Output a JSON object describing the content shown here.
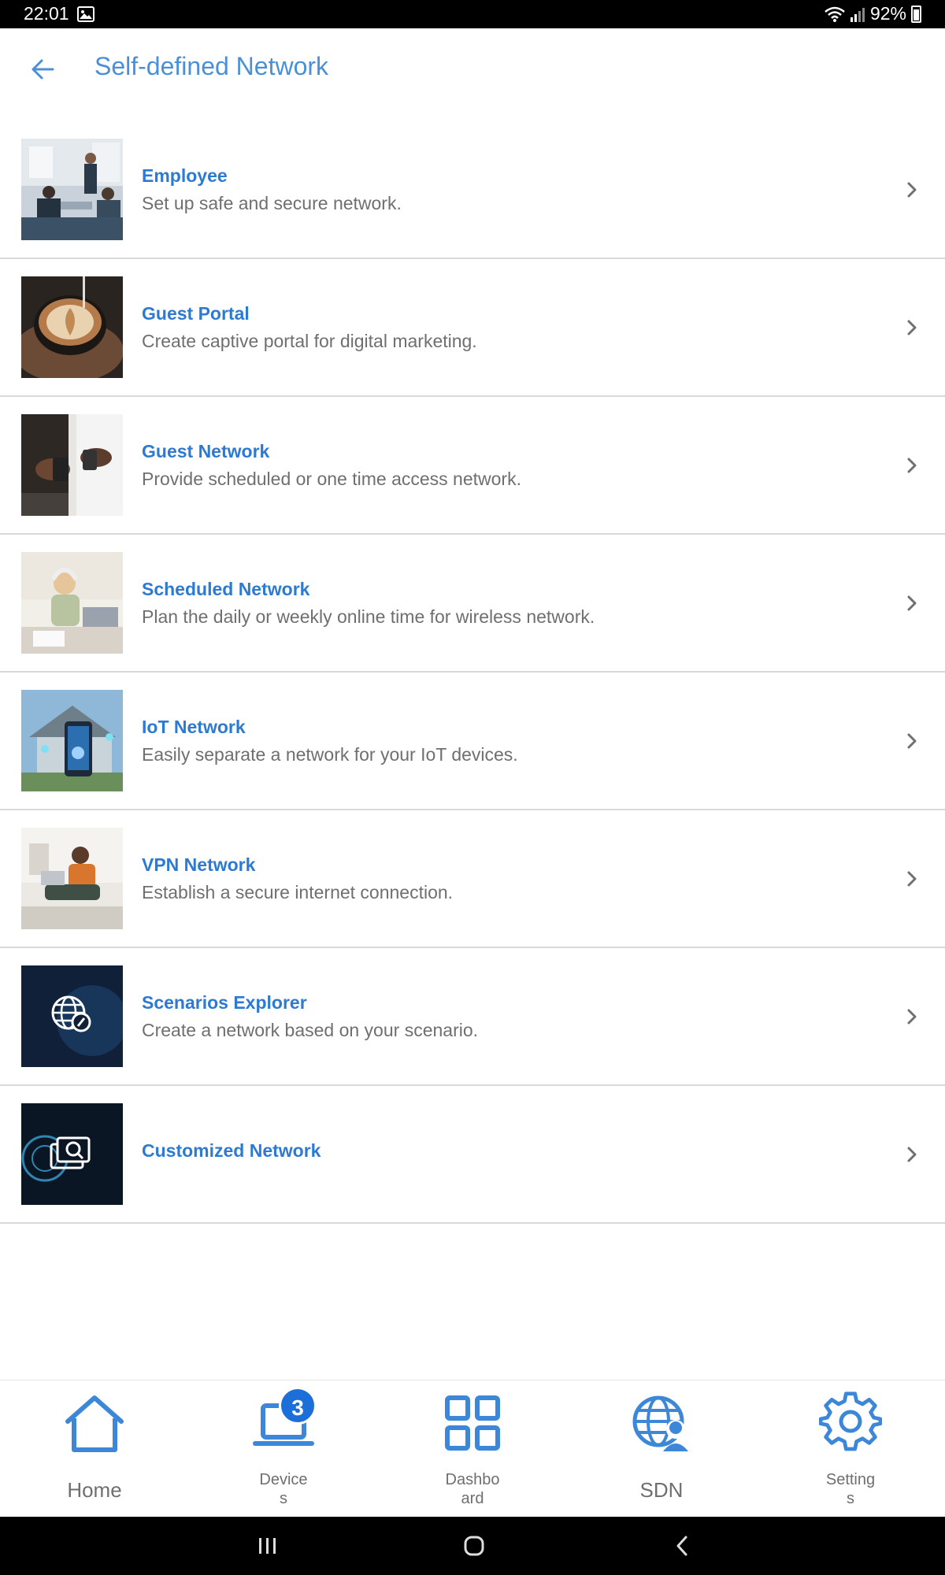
{
  "status_bar": {
    "time": "22:01",
    "battery": "92%",
    "icons": [
      "image-icon",
      "wifi-icon",
      "signal-icon",
      "battery-icon"
    ]
  },
  "header": {
    "title": "Self-defined Network",
    "back_icon": "arrow-left-icon"
  },
  "scenarios": [
    {
      "title": "Employee",
      "description": "Set up safe and secure network."
    },
    {
      "title": "Guest Portal",
      "description": "Create captive portal for digital marketing."
    },
    {
      "title": "Guest Network",
      "description": "Provide scheduled or one time access network."
    },
    {
      "title": "Scheduled Network",
      "description": "Plan the daily or weekly online time for wireless network."
    },
    {
      "title": "IoT Network",
      "description": "Easily separate a network for your IoT devices."
    },
    {
      "title": "VPN Network",
      "description": "Establish a secure internet connection."
    },
    {
      "title": "Scenarios Explorer",
      "description": "Create a network based on your scenario."
    },
    {
      "title": "Customized Network",
      "description": ""
    }
  ],
  "bottom_nav": {
    "home": "Home",
    "devices_line1": "Device",
    "devices_line2": "s",
    "devices_badge": "3",
    "dashboard_line1": "Dashbo",
    "dashboard_line2": "ard",
    "sdn": "SDN",
    "settings_line1": "Setting",
    "settings_line2": "s"
  },
  "colors": {
    "accent": "#4a90d9",
    "title_blue": "#2d7ad2",
    "badge": "#1c6fd9",
    "nav_icon": "#3d87d8"
  }
}
